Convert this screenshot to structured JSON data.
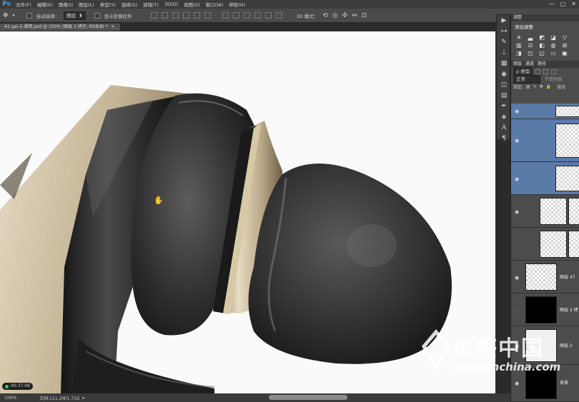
{
  "app": {
    "logo": "Ps"
  },
  "menu": [
    "文件(F)",
    "编辑(E)",
    "图像(I)",
    "图层(L)",
    "类型(Y)",
    "选择(S)",
    "滤镜(T)",
    "3D(D)",
    "视图(V)",
    "窗口(W)",
    "帮助(H)"
  ],
  "window_controls": [
    "—",
    "□",
    "✕"
  ],
  "options_bar": {
    "auto_select_label": "自动选择：",
    "auto_select_value": "图层",
    "show_transform_label": "显示变换控件",
    "mode_3d_label": "3D 模式："
  },
  "document": {
    "tab_label": "A1-gai-2-课用.psd @ 100% (图层 2 拷贝, RGB/8) *",
    "tab_close": "×"
  },
  "status": {
    "zoom": "100%",
    "doc_info": "文档:111.2M/1.71G",
    "timer": "00:37:09"
  },
  "panels": {
    "adjust_tab": "调整",
    "add_adjustment": "添加调整",
    "layer_tabs": [
      "图层",
      "通道",
      "路径"
    ],
    "kind_label": "ρ 类型",
    "blend_mode": "正常",
    "opacity_label": "不透明度:",
    "lock_label": "锁定:",
    "fill_label": "填充"
  },
  "layers": [
    {
      "name": "",
      "selected": true
    },
    {
      "name": "",
      "selected": true
    },
    {
      "name": "",
      "selected": true
    },
    {
      "name": "",
      "selected": false
    },
    {
      "name": "",
      "selected": false
    },
    {
      "name": "图层 47",
      "selected": false
    },
    {
      "name": "图层 2 拷",
      "selected": false
    },
    {
      "name": "图层 2",
      "selected": false
    },
    {
      "name": "背景",
      "selected": false
    }
  ],
  "watermark": {
    "title": "灵感中国",
    "url": "lingganchina.com"
  },
  "colors": {
    "accent": "#2fa3ff",
    "selected_layer": "#5a7aa8",
    "earbud_black": "#2a2a2a",
    "metal_gold": "#b9a787"
  }
}
